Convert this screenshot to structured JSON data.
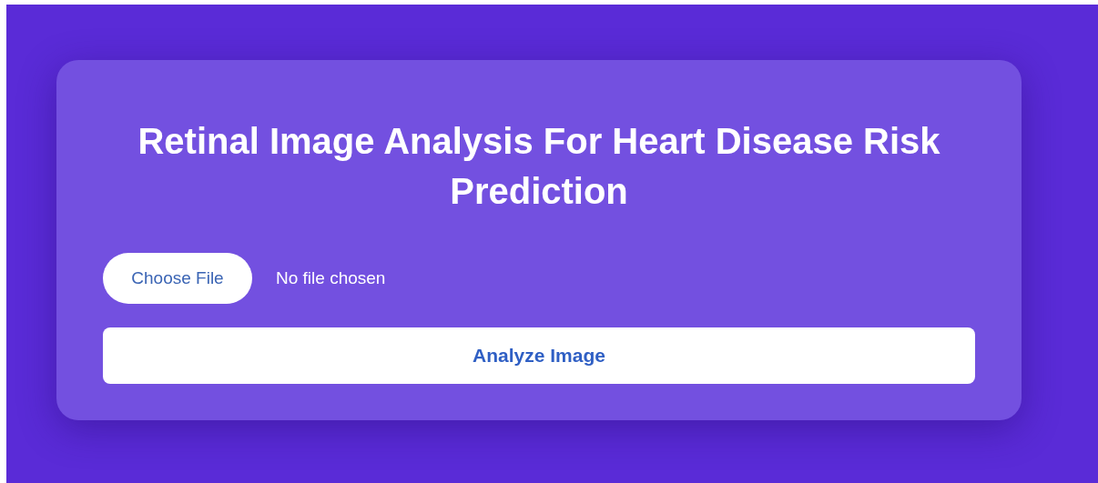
{
  "card": {
    "title": "Retinal Image Analysis For Heart Disease Risk Prediction",
    "file_input": {
      "button": "Choose File",
      "status": "No file chosen"
    },
    "submit_button": "Analyze Image"
  }
}
